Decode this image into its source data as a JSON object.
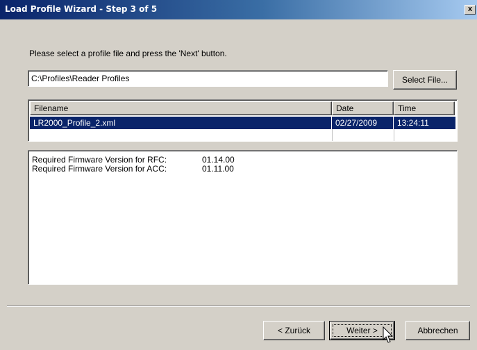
{
  "window": {
    "title": "Load Profile Wizard - Step 3 of 5",
    "close_label": "x"
  },
  "instruction": "Please select a profile file and press the 'Next' button.",
  "file_path": {
    "value": "C:\\Profiles\\Reader Profiles"
  },
  "select_file_label": "Select File...",
  "file_list": {
    "columns": [
      "Filename",
      "Date",
      "Time"
    ],
    "rows": [
      {
        "filename": "LR2000_Profile_2.xml",
        "date": "02/27/2009",
        "time": "13:24:11",
        "selected": true
      }
    ]
  },
  "info": {
    "lines": [
      {
        "label": "Required Firmware Version for RFC:",
        "value": "01.14.00"
      },
      {
        "label": "Required Firmware Version for ACC:",
        "value": "01.11.00"
      }
    ]
  },
  "buttons": {
    "back": "< Zurück",
    "next": "Weiter >",
    "cancel": "Abbrechen"
  },
  "colors": {
    "selection": "#0a246a",
    "dialog_bg": "#d4d0c8",
    "title_start": "#0a246a",
    "title_end": "#a6caf0"
  }
}
